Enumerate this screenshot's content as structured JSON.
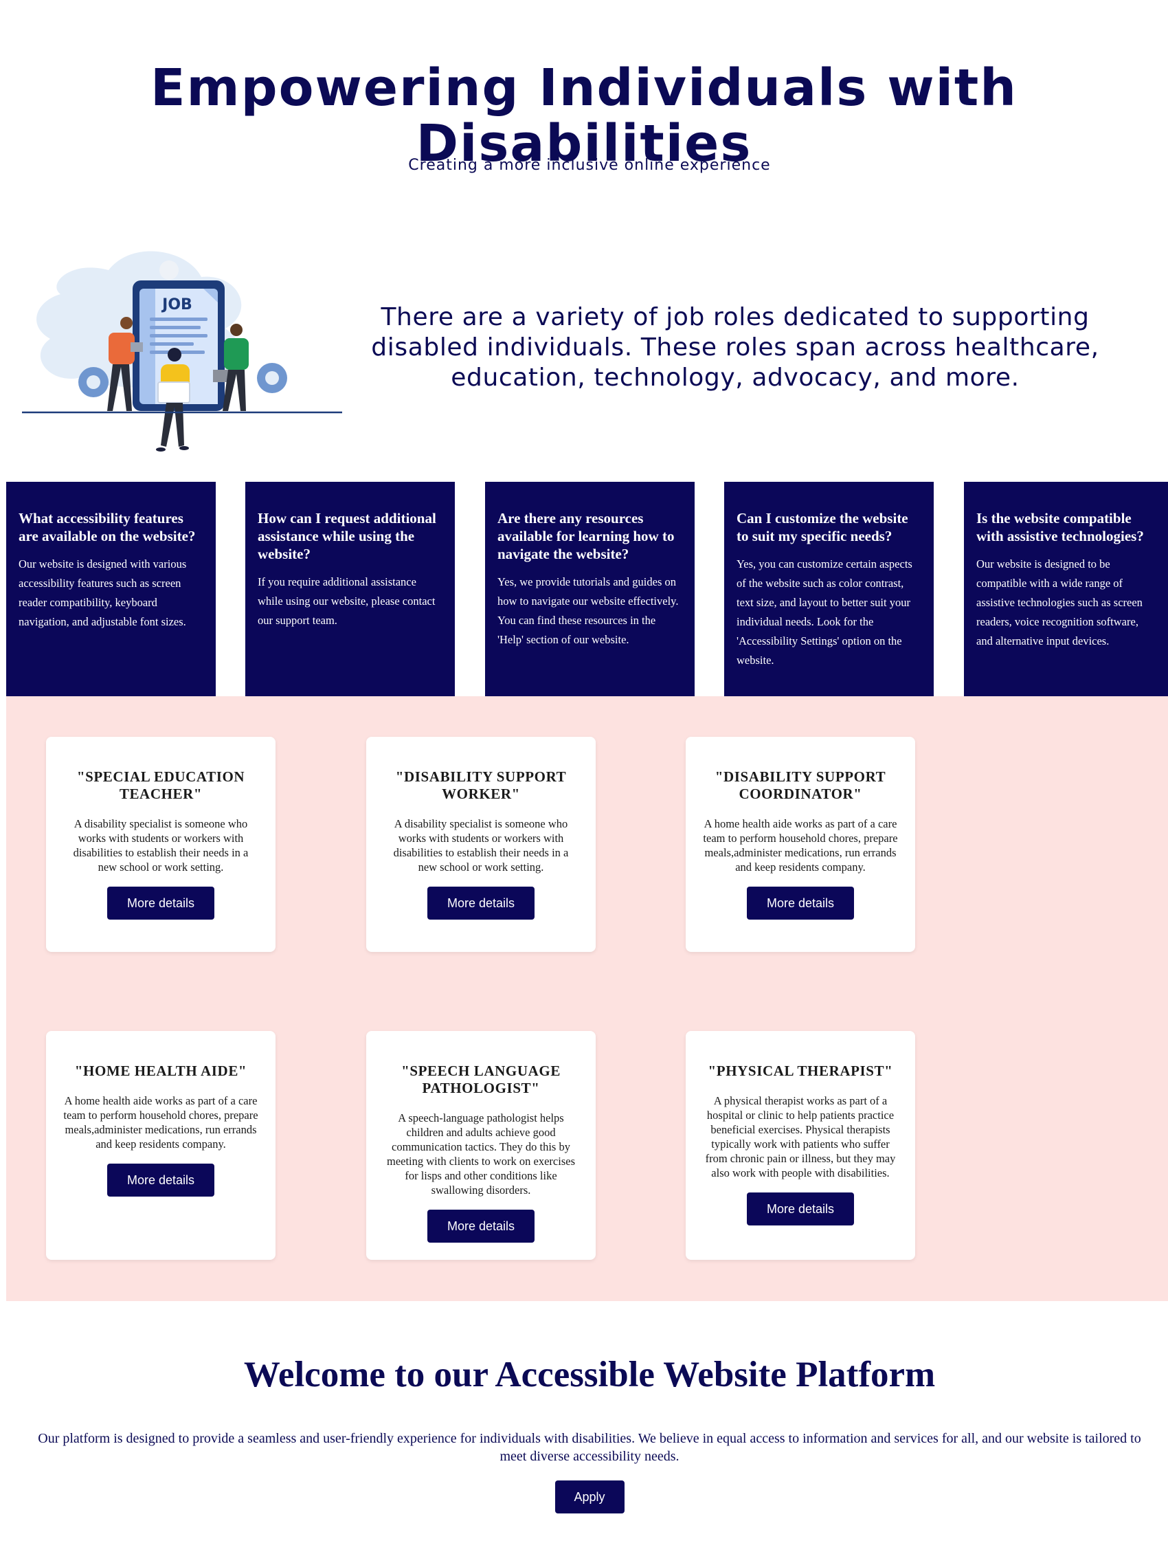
{
  "hero": {
    "title": "Empowering Individuals with Disabilities",
    "subtitle": "Creating a more inclusive online experience"
  },
  "illustration": {
    "sign_text": "JOB",
    "icon": "job-search-illustration"
  },
  "intro": {
    "text": "There are a variety of job roles dedicated to supporting disabled individuals. These roles span across healthcare, education, technology, advocacy, and more."
  },
  "faq": [
    {
      "question": "What accessibility features are available on the website?",
      "answer": "Our website is designed with various accessibility features such as screen reader compatibility, keyboard navigation, and adjustable font sizes."
    },
    {
      "question": "How can I request additional assistance while using the website?",
      "answer": "If you require additional assistance while using our website, please contact our support team."
    },
    {
      "question": "Are there any resources available for learning how to navigate the website?",
      "answer": "Yes, we provide tutorials and guides on how to navigate our website effectively. You can find these resources in the 'Help' section of our website."
    },
    {
      "question": "Can I customize the website to suit my specific needs?",
      "answer": "Yes, you can customize certain aspects of the website such as color contrast, text size, and layout to better suit your individual needs. Look for the 'Accessibility Settings' option on the website."
    },
    {
      "question": "Is the website compatible with assistive technologies?",
      "answer": "Our website is designed to be compatible with a wide range of assistive technologies such as screen readers, voice recognition software, and alternative input devices."
    }
  ],
  "jobs": [
    {
      "title": "\"SPECIAL EDUCATION TEACHER\"",
      "description": "A disability specialist is someone who works with students or workers with disabilities to establish their needs in a new school or work setting.",
      "button": "More details"
    },
    {
      "title": "\"DISABILITY SUPPORT WORKER\"",
      "description": "A disability specialist is someone who works with students or workers with disabilities to establish their needs in a new school or work setting.",
      "button": "More details"
    },
    {
      "title": "\"DISABILITY SUPPORT COORDINATOR\"",
      "description": "A home health aide works as part of a care team to perform household chores, prepare meals,administer medications, run errands and keep residents company.",
      "button": "More details"
    },
    {
      "title": "\"HOME HEALTH AIDE\"",
      "description": "A home health aide works as part of a care team to perform household chores, prepare meals,administer medications, run errands and keep residents company.",
      "button": "More details"
    },
    {
      "title": "\"SPEECH LANGUAGE PATHOLOGIST\"",
      "description": "A speech-language pathologist helps children and adults achieve good communication tactics. They do this by meeting with clients to work on exercises for lisps and other conditions like swallowing disorders.",
      "button": "More details"
    },
    {
      "title": "\"PHYSICAL THERAPIST\"",
      "description": "A physical therapist works as part of a hospital or clinic to help patients practice beneficial exercises. Physical therapists typically work with patients who suffer from chronic pain or illness, but they may also work with people with disabilities.",
      "button": "More details"
    }
  ],
  "welcome": {
    "title": "Welcome to our Accessible Website Platform",
    "text": "Our platform is designed to provide a seamless and user-friendly experience for individuals with disabilities. We believe in equal access to information and services for all, and our website is tailored to meet diverse accessibility needs.",
    "apply_label": "Apply"
  },
  "colors": {
    "navy": "#0b0759",
    "pink_bg": "#fde2e0",
    "white": "#ffffff"
  }
}
